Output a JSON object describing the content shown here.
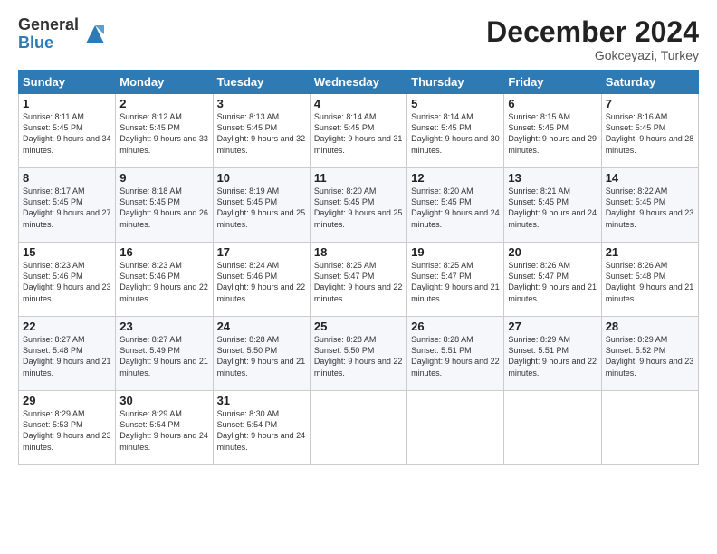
{
  "logo": {
    "general": "General",
    "blue": "Blue"
  },
  "header": {
    "month": "December 2024",
    "location": "Gokceyazi, Turkey"
  },
  "days": [
    "Sunday",
    "Monday",
    "Tuesday",
    "Wednesday",
    "Thursday",
    "Friday",
    "Saturday"
  ],
  "weeks": [
    [
      {
        "day": "1",
        "sunrise": "8:11 AM",
        "sunset": "5:45 PM",
        "daylight": "9 hours and 34 minutes."
      },
      {
        "day": "2",
        "sunrise": "8:12 AM",
        "sunset": "5:45 PM",
        "daylight": "9 hours and 33 minutes."
      },
      {
        "day": "3",
        "sunrise": "8:13 AM",
        "sunset": "5:45 PM",
        "daylight": "9 hours and 32 minutes."
      },
      {
        "day": "4",
        "sunrise": "8:14 AM",
        "sunset": "5:45 PM",
        "daylight": "9 hours and 31 minutes."
      },
      {
        "day": "5",
        "sunrise": "8:14 AM",
        "sunset": "5:45 PM",
        "daylight": "9 hours and 30 minutes."
      },
      {
        "day": "6",
        "sunrise": "8:15 AM",
        "sunset": "5:45 PM",
        "daylight": "9 hours and 29 minutes."
      },
      {
        "day": "7",
        "sunrise": "8:16 AM",
        "sunset": "5:45 PM",
        "daylight": "9 hours and 28 minutes."
      }
    ],
    [
      {
        "day": "8",
        "sunrise": "8:17 AM",
        "sunset": "5:45 PM",
        "daylight": "9 hours and 27 minutes."
      },
      {
        "day": "9",
        "sunrise": "8:18 AM",
        "sunset": "5:45 PM",
        "daylight": "9 hours and 26 minutes."
      },
      {
        "day": "10",
        "sunrise": "8:19 AM",
        "sunset": "5:45 PM",
        "daylight": "9 hours and 25 minutes."
      },
      {
        "day": "11",
        "sunrise": "8:20 AM",
        "sunset": "5:45 PM",
        "daylight": "9 hours and 25 minutes."
      },
      {
        "day": "12",
        "sunrise": "8:20 AM",
        "sunset": "5:45 PM",
        "daylight": "9 hours and 24 minutes."
      },
      {
        "day": "13",
        "sunrise": "8:21 AM",
        "sunset": "5:45 PM",
        "daylight": "9 hours and 24 minutes."
      },
      {
        "day": "14",
        "sunrise": "8:22 AM",
        "sunset": "5:45 PM",
        "daylight": "9 hours and 23 minutes."
      }
    ],
    [
      {
        "day": "15",
        "sunrise": "8:23 AM",
        "sunset": "5:46 PM",
        "daylight": "9 hours and 23 minutes."
      },
      {
        "day": "16",
        "sunrise": "8:23 AM",
        "sunset": "5:46 PM",
        "daylight": "9 hours and 22 minutes."
      },
      {
        "day": "17",
        "sunrise": "8:24 AM",
        "sunset": "5:46 PM",
        "daylight": "9 hours and 22 minutes."
      },
      {
        "day": "18",
        "sunrise": "8:25 AM",
        "sunset": "5:47 PM",
        "daylight": "9 hours and 22 minutes."
      },
      {
        "day": "19",
        "sunrise": "8:25 AM",
        "sunset": "5:47 PM",
        "daylight": "9 hours and 21 minutes."
      },
      {
        "day": "20",
        "sunrise": "8:26 AM",
        "sunset": "5:47 PM",
        "daylight": "9 hours and 21 minutes."
      },
      {
        "day": "21",
        "sunrise": "8:26 AM",
        "sunset": "5:48 PM",
        "daylight": "9 hours and 21 minutes."
      }
    ],
    [
      {
        "day": "22",
        "sunrise": "8:27 AM",
        "sunset": "5:48 PM",
        "daylight": "9 hours and 21 minutes."
      },
      {
        "day": "23",
        "sunrise": "8:27 AM",
        "sunset": "5:49 PM",
        "daylight": "9 hours and 21 minutes."
      },
      {
        "day": "24",
        "sunrise": "8:28 AM",
        "sunset": "5:50 PM",
        "daylight": "9 hours and 21 minutes."
      },
      {
        "day": "25",
        "sunrise": "8:28 AM",
        "sunset": "5:50 PM",
        "daylight": "9 hours and 22 minutes."
      },
      {
        "day": "26",
        "sunrise": "8:28 AM",
        "sunset": "5:51 PM",
        "daylight": "9 hours and 22 minutes."
      },
      {
        "day": "27",
        "sunrise": "8:29 AM",
        "sunset": "5:51 PM",
        "daylight": "9 hours and 22 minutes."
      },
      {
        "day": "28",
        "sunrise": "8:29 AM",
        "sunset": "5:52 PM",
        "daylight": "9 hours and 23 minutes."
      }
    ],
    [
      {
        "day": "29",
        "sunrise": "8:29 AM",
        "sunset": "5:53 PM",
        "daylight": "9 hours and 23 minutes."
      },
      {
        "day": "30",
        "sunrise": "8:29 AM",
        "sunset": "5:54 PM",
        "daylight": "9 hours and 24 minutes."
      },
      {
        "day": "31",
        "sunrise": "8:30 AM",
        "sunset": "5:54 PM",
        "daylight": "9 hours and 24 minutes."
      },
      null,
      null,
      null,
      null
    ]
  ]
}
